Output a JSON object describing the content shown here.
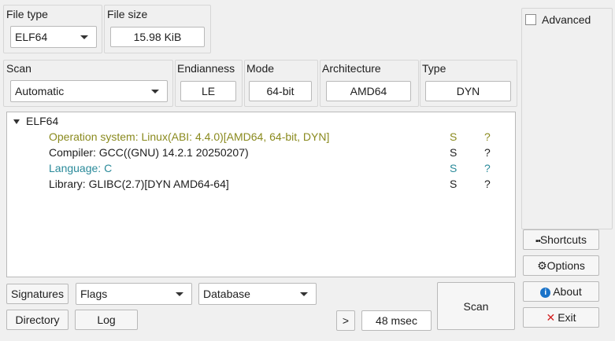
{
  "file_type": {
    "label": "File type",
    "value": "ELF64"
  },
  "file_size": {
    "label": "File size",
    "value": "15.98 KiB"
  },
  "scan": {
    "label": "Scan",
    "value": "Automatic"
  },
  "endianness": {
    "label": "Endianness",
    "value": "LE"
  },
  "mode": {
    "label": "Mode",
    "value": "64-bit"
  },
  "architecture": {
    "label": "Architecture",
    "value": "AMD64"
  },
  "type": {
    "label": "Type",
    "value": "DYN"
  },
  "advanced": {
    "label": "Advanced",
    "checked": false
  },
  "tree": {
    "root": "ELF64",
    "items": [
      {
        "text": "Operation system: Linux(ABI: 4.4.0)[AMD64, 64-bit, DYN]",
        "s": "S",
        "q": "?",
        "color": "#8a8a1e"
      },
      {
        "text": "Compiler: GCC((GNU) 14.2.1 20250207)",
        "s": "S",
        "q": "?",
        "color": "#1e1e1e"
      },
      {
        "text": "Language: C",
        "s": "S",
        "q": "?",
        "color": "#2a8a9a"
      },
      {
        "text": "Library: GLIBC(2.7)[DYN AMD64-64]",
        "s": "S",
        "q": "?",
        "color": "#1e1e1e"
      }
    ]
  },
  "sidebar": {
    "shortcuts": "Shortcuts",
    "options": "Options",
    "about": "About",
    "exit": "Exit"
  },
  "bottom": {
    "signatures": "Signatures",
    "flags": "Flags",
    "database": "Database",
    "directory": "Directory",
    "log": "Log",
    "more": ">",
    "time": "48 msec",
    "scan": "Scan"
  },
  "colors": {
    "olive": "#8a8a1e",
    "teal": "#2a8a9a",
    "exit_red": "#d22020",
    "about_blue": "#1a73c9"
  }
}
